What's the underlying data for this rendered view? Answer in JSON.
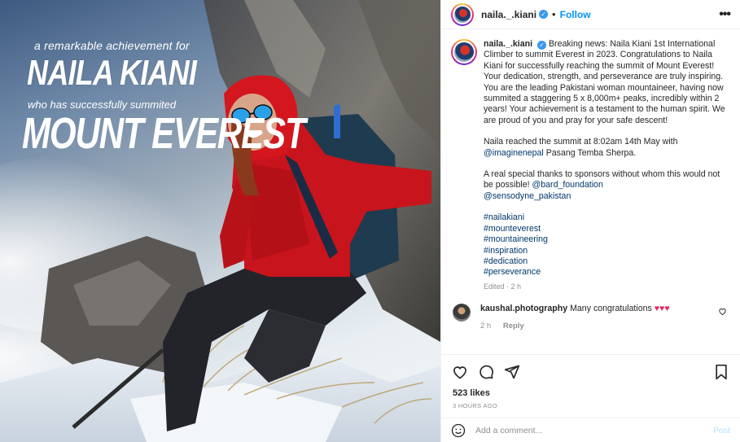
{
  "photo": {
    "overlay_line1": "a remarkable achievement for",
    "overlay_name": "NAILA KIANI",
    "overlay_line2": "who has successfully summited",
    "overlay_title": "MOUNT EVEREST"
  },
  "header": {
    "username": "naila._.kiani",
    "separator": "•",
    "follow_label": "Follow",
    "more_label": "•••"
  },
  "caption": {
    "username": "naila._.kiani",
    "paragraph1": "Breaking news: Naila Kiani 1st International Climber to summit Everest in 2023. Congratulations to Naila Kiani for successfully reaching the summit of Mount Everest! Your dedication, strength, and perseverance are truly inspiring. You are the leading Pakistani woman mountaineer, having now summited a staggering 5 x 8,000m+ peaks, incredibly within 2 years! Your achievement is a testament to the human spirit. We are proud of you and pray for your safe descent!",
    "paragraph2_text": "Naila reached the summit at 8:02am 14th May with",
    "paragraph2_mention": "@imaginenepal",
    "paragraph2_rest": " Pasang Temba Sherpa.",
    "paragraph3_text": "A real special thanks to sponsors without whom this would not be possible!",
    "paragraph3_mention1": "@bard_foundation",
    "paragraph3_mention2": "@sensodyne_pakistan",
    "hashtags": [
      "#nailakiani",
      "#mounteverest",
      "#mountaineering",
      "#inspiration",
      "#dedication",
      "#perseverance"
    ],
    "edited": "Edited · 2 h"
  },
  "comment": {
    "username": "kaushal.photography",
    "text": "Many congratulations",
    "hearts": "♥♥♥",
    "time": "2 h",
    "reply_label": "Reply"
  },
  "actions": {
    "like_icon": "heart-icon",
    "comment_icon": "comment-icon",
    "share_icon": "share-icon",
    "save_icon": "bookmark-icon"
  },
  "likes": "523 likes",
  "time_ago": "3 HOURS AGO",
  "add_comment": {
    "placeholder": "Add a comment...",
    "post_label": "Post"
  }
}
